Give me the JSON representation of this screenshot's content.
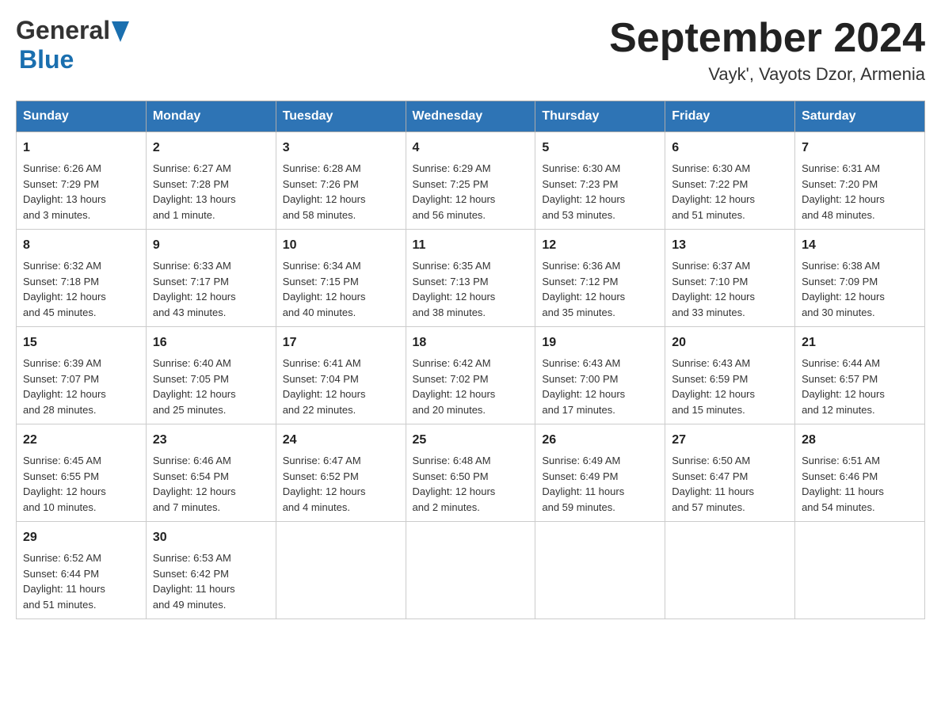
{
  "header": {
    "logo_general": "General",
    "logo_blue": "Blue",
    "month_title": "September 2024",
    "location": "Vayk', Vayots Dzor, Armenia"
  },
  "days_of_week": [
    "Sunday",
    "Monday",
    "Tuesday",
    "Wednesday",
    "Thursday",
    "Friday",
    "Saturday"
  ],
  "weeks": [
    [
      {
        "day": 1,
        "sunrise": "6:26 AM",
        "sunset": "7:29 PM",
        "daylight": "13 hours and 3 minutes."
      },
      {
        "day": 2,
        "sunrise": "6:27 AM",
        "sunset": "7:28 PM",
        "daylight": "13 hours and 1 minute."
      },
      {
        "day": 3,
        "sunrise": "6:28 AM",
        "sunset": "7:26 PM",
        "daylight": "12 hours and 58 minutes."
      },
      {
        "day": 4,
        "sunrise": "6:29 AM",
        "sunset": "7:25 PM",
        "daylight": "12 hours and 56 minutes."
      },
      {
        "day": 5,
        "sunrise": "6:30 AM",
        "sunset": "7:23 PM",
        "daylight": "12 hours and 53 minutes."
      },
      {
        "day": 6,
        "sunrise": "6:30 AM",
        "sunset": "7:22 PM",
        "daylight": "12 hours and 51 minutes."
      },
      {
        "day": 7,
        "sunrise": "6:31 AM",
        "sunset": "7:20 PM",
        "daylight": "12 hours and 48 minutes."
      }
    ],
    [
      {
        "day": 8,
        "sunrise": "6:32 AM",
        "sunset": "7:18 PM",
        "daylight": "12 hours and 45 minutes."
      },
      {
        "day": 9,
        "sunrise": "6:33 AM",
        "sunset": "7:17 PM",
        "daylight": "12 hours and 43 minutes."
      },
      {
        "day": 10,
        "sunrise": "6:34 AM",
        "sunset": "7:15 PM",
        "daylight": "12 hours and 40 minutes."
      },
      {
        "day": 11,
        "sunrise": "6:35 AM",
        "sunset": "7:13 PM",
        "daylight": "12 hours and 38 minutes."
      },
      {
        "day": 12,
        "sunrise": "6:36 AM",
        "sunset": "7:12 PM",
        "daylight": "12 hours and 35 minutes."
      },
      {
        "day": 13,
        "sunrise": "6:37 AM",
        "sunset": "7:10 PM",
        "daylight": "12 hours and 33 minutes."
      },
      {
        "day": 14,
        "sunrise": "6:38 AM",
        "sunset": "7:09 PM",
        "daylight": "12 hours and 30 minutes."
      }
    ],
    [
      {
        "day": 15,
        "sunrise": "6:39 AM",
        "sunset": "7:07 PM",
        "daylight": "12 hours and 28 minutes."
      },
      {
        "day": 16,
        "sunrise": "6:40 AM",
        "sunset": "7:05 PM",
        "daylight": "12 hours and 25 minutes."
      },
      {
        "day": 17,
        "sunrise": "6:41 AM",
        "sunset": "7:04 PM",
        "daylight": "12 hours and 22 minutes."
      },
      {
        "day": 18,
        "sunrise": "6:42 AM",
        "sunset": "7:02 PM",
        "daylight": "12 hours and 20 minutes."
      },
      {
        "day": 19,
        "sunrise": "6:43 AM",
        "sunset": "7:00 PM",
        "daylight": "12 hours and 17 minutes."
      },
      {
        "day": 20,
        "sunrise": "6:43 AM",
        "sunset": "6:59 PM",
        "daylight": "12 hours and 15 minutes."
      },
      {
        "day": 21,
        "sunrise": "6:44 AM",
        "sunset": "6:57 PM",
        "daylight": "12 hours and 12 minutes."
      }
    ],
    [
      {
        "day": 22,
        "sunrise": "6:45 AM",
        "sunset": "6:55 PM",
        "daylight": "12 hours and 10 minutes."
      },
      {
        "day": 23,
        "sunrise": "6:46 AM",
        "sunset": "6:54 PM",
        "daylight": "12 hours and 7 minutes."
      },
      {
        "day": 24,
        "sunrise": "6:47 AM",
        "sunset": "6:52 PM",
        "daylight": "12 hours and 4 minutes."
      },
      {
        "day": 25,
        "sunrise": "6:48 AM",
        "sunset": "6:50 PM",
        "daylight": "12 hours and 2 minutes."
      },
      {
        "day": 26,
        "sunrise": "6:49 AM",
        "sunset": "6:49 PM",
        "daylight": "11 hours and 59 minutes."
      },
      {
        "day": 27,
        "sunrise": "6:50 AM",
        "sunset": "6:47 PM",
        "daylight": "11 hours and 57 minutes."
      },
      {
        "day": 28,
        "sunrise": "6:51 AM",
        "sunset": "6:46 PM",
        "daylight": "11 hours and 54 minutes."
      }
    ],
    [
      {
        "day": 29,
        "sunrise": "6:52 AM",
        "sunset": "6:44 PM",
        "daylight": "11 hours and 51 minutes."
      },
      {
        "day": 30,
        "sunrise": "6:53 AM",
        "sunset": "6:42 PM",
        "daylight": "11 hours and 49 minutes."
      },
      null,
      null,
      null,
      null,
      null
    ]
  ],
  "labels": {
    "sunrise": "Sunrise:",
    "sunset": "Sunset:",
    "daylight": "Daylight:"
  }
}
